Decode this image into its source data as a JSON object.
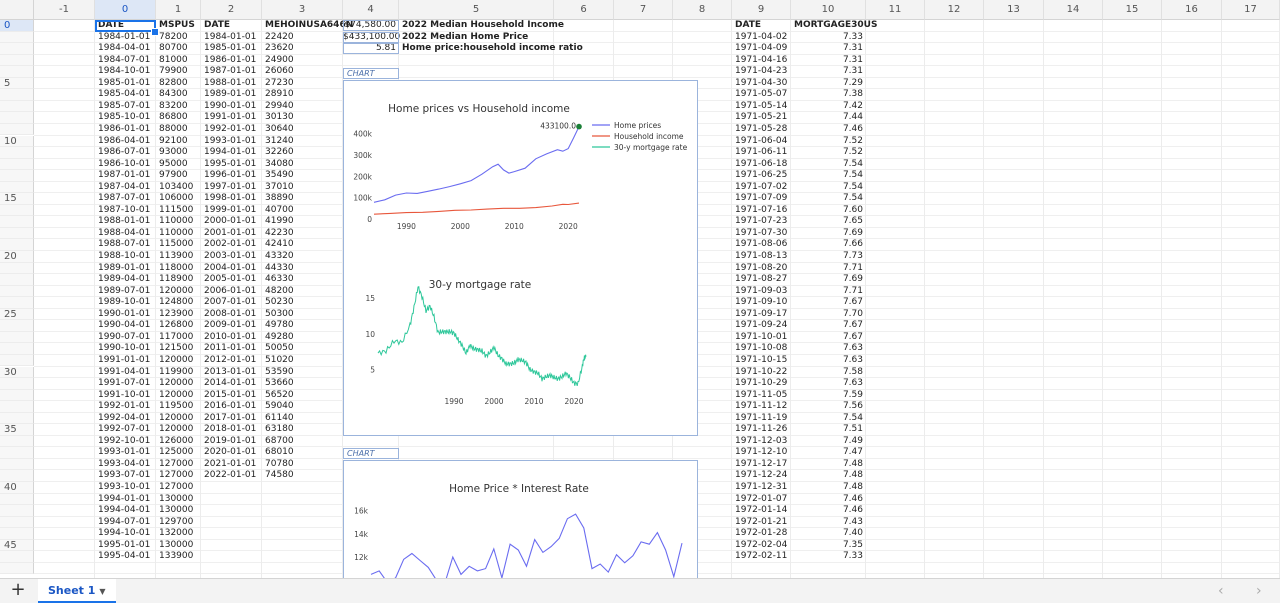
{
  "columns": [
    "-1",
    "0",
    "1",
    "2",
    "3",
    "4",
    "5",
    "6",
    "7",
    "8",
    "9",
    "10",
    "11",
    "12",
    "13",
    "14",
    "15",
    "16",
    "17"
  ],
  "row_markers": [
    "0",
    "5",
    "10",
    "15",
    "20",
    "25",
    "30",
    "35",
    "40",
    "45"
  ],
  "headers": {
    "c0": "DATE",
    "c1": "MSPUS",
    "c2": "DATE",
    "c3": "MEHOINUSA646N",
    "c9": "DATE",
    "c10": "MORTGAGE30US"
  },
  "col0": [
    "1984-01-01",
    "1984-04-01",
    "1984-07-01",
    "1984-10-01",
    "1985-01-01",
    "1985-04-01",
    "1985-07-01",
    "1985-10-01",
    "1986-01-01",
    "1986-04-01",
    "1986-07-01",
    "1986-10-01",
    "1987-01-01",
    "1987-04-01",
    "1987-07-01",
    "1987-10-01",
    "1988-01-01",
    "1988-04-01",
    "1988-07-01",
    "1988-10-01",
    "1989-01-01",
    "1989-04-01",
    "1989-07-01",
    "1989-10-01",
    "1990-01-01",
    "1990-04-01",
    "1990-07-01",
    "1990-10-01",
    "1991-01-01",
    "1991-04-01",
    "1991-07-01",
    "1991-10-01",
    "1992-01-01",
    "1992-04-01",
    "1992-07-01",
    "1992-10-01",
    "1993-01-01",
    "1993-04-01",
    "1993-07-01",
    "1993-10-01",
    "1994-01-01",
    "1994-04-01",
    "1994-07-01",
    "1994-10-01",
    "1995-01-01",
    "1995-04-01"
  ],
  "col1": [
    "78200",
    "80700",
    "81000",
    "79900",
    "82800",
    "84300",
    "83200",
    "86800",
    "88000",
    "92100",
    "93000",
    "95000",
    "97900",
    "103400",
    "106000",
    "111500",
    "110000",
    "110000",
    "115000",
    "113900",
    "118000",
    "118900",
    "120000",
    "124800",
    "123900",
    "126800",
    "117000",
    "121500",
    "120000",
    "119900",
    "120000",
    "120000",
    "119500",
    "120000",
    "120000",
    "126000",
    "125000",
    "127000",
    "127000",
    "127000",
    "130000",
    "130000",
    "129700",
    "132000",
    "130000",
    "133900"
  ],
  "col2": [
    "1984-01-01",
    "1985-01-01",
    "1986-01-01",
    "1987-01-01",
    "1988-01-01",
    "1989-01-01",
    "1990-01-01",
    "1991-01-01",
    "1992-01-01",
    "1993-01-01",
    "1994-01-01",
    "1995-01-01",
    "1996-01-01",
    "1997-01-01",
    "1998-01-01",
    "1999-01-01",
    "2000-01-01",
    "2001-01-01",
    "2002-01-01",
    "2003-01-01",
    "2004-01-01",
    "2005-01-01",
    "2006-01-01",
    "2007-01-01",
    "2008-01-01",
    "2009-01-01",
    "2010-01-01",
    "2011-01-01",
    "2012-01-01",
    "2013-01-01",
    "2014-01-01",
    "2015-01-01",
    "2016-01-01",
    "2017-01-01",
    "2018-01-01",
    "2019-01-01",
    "2020-01-01",
    "2021-01-01",
    "2022-01-01"
  ],
  "col3": [
    "22420",
    "23620",
    "24900",
    "26060",
    "27230",
    "28910",
    "29940",
    "30130",
    "30640",
    "31240",
    "32260",
    "34080",
    "35490",
    "37010",
    "38890",
    "40700",
    "41990",
    "42230",
    "42410",
    "43320",
    "44330",
    "46330",
    "48200",
    "50230",
    "50300",
    "49780",
    "49280",
    "50050",
    "51020",
    "53590",
    "53660",
    "56520",
    "59040",
    "61140",
    "63180",
    "68700",
    "68010",
    "70780",
    "74580"
  ],
  "summary": [
    {
      "value": "$74,580.00",
      "label": "2022 Median Household Income"
    },
    {
      "value": "$433,100.00",
      "label": "2022 Median Home Price"
    },
    {
      "value": "5.81",
      "label": "Home price:household income ratio"
    }
  ],
  "col9": [
    "1971-04-02",
    "1971-04-09",
    "1971-04-16",
    "1971-04-23",
    "1971-04-30",
    "1971-05-07",
    "1971-05-14",
    "1971-05-21",
    "1971-05-28",
    "1971-06-04",
    "1971-06-11",
    "1971-06-18",
    "1971-06-25",
    "1971-07-02",
    "1971-07-09",
    "1971-07-16",
    "1971-07-23",
    "1971-07-30",
    "1971-08-06",
    "1971-08-13",
    "1971-08-20",
    "1971-08-27",
    "1971-09-03",
    "1971-09-10",
    "1971-09-17",
    "1971-09-24",
    "1971-10-01",
    "1971-10-08",
    "1971-10-15",
    "1971-10-22",
    "1971-10-29",
    "1971-11-05",
    "1971-11-12",
    "1971-11-19",
    "1971-11-26",
    "1971-12-03",
    "1971-12-10",
    "1971-12-17",
    "1971-12-24",
    "1971-12-31",
    "1972-01-07",
    "1972-01-14",
    "1972-01-21",
    "1972-01-28",
    "1972-02-04",
    "1972-02-11"
  ],
  "col10": [
    "7.33",
    "7.31",
    "7.31",
    "7.31",
    "7.29",
    "7.38",
    "7.42",
    "7.44",
    "7.46",
    "7.52",
    "7.52",
    "7.54",
    "7.54",
    "7.54",
    "7.54",
    "7.60",
    "7.65",
    "7.69",
    "7.66",
    "7.73",
    "7.71",
    "7.69",
    "7.71",
    "7.67",
    "7.70",
    "7.67",
    "7.67",
    "7.63",
    "7.63",
    "7.58",
    "7.63",
    "7.59",
    "7.56",
    "7.54",
    "7.51",
    "7.49",
    "7.47",
    "7.48",
    "7.48",
    "7.48",
    "7.46",
    "7.46",
    "7.43",
    "7.40",
    "7.35",
    "7.33"
  ],
  "chart_tag_label": "CHART",
  "sheet_tab": "Sheet 1",
  "add_sheet": "+",
  "chart_data": [
    {
      "type": "line",
      "title": "Home prices vs Household income",
      "xlim": [
        1984,
        2022
      ],
      "ylim": [
        0,
        450000
      ],
      "y_ticks": [
        {
          "v": 0,
          "label": "0"
        },
        {
          "v": 100000,
          "label": "100k"
        },
        {
          "v": 200000,
          "label": "200k"
        },
        {
          "v": 300000,
          "label": "300k"
        },
        {
          "v": 400000,
          "label": "400k"
        }
      ],
      "x_ticks": [
        1990,
        2000,
        2010,
        2020
      ],
      "annotation": {
        "x": 2022,
        "y": 433100,
        "label": "433100.0"
      },
      "legend_position": "top-right",
      "series": [
        {
          "name": "Home prices",
          "color": "#6a6cf0",
          "points": [
            [
              1984,
              78200
            ],
            [
              1986,
              90000
            ],
            [
              1988,
              112000
            ],
            [
              1990,
              122000
            ],
            [
              1992,
              120000
            ],
            [
              1994,
              130000
            ],
            [
              1996,
              140000
            ],
            [
              1998,
              152000
            ],
            [
              2000,
              165000
            ],
            [
              2002,
              180000
            ],
            [
              2004,
              210000
            ],
            [
              2006,
              245000
            ],
            [
              2007,
              257000
            ],
            [
              2008,
              230000
            ],
            [
              2009,
              215000
            ],
            [
              2010,
              222000
            ],
            [
              2012,
              238000
            ],
            [
              2014,
              282000
            ],
            [
              2016,
              305000
            ],
            [
              2018,
              325000
            ],
            [
              2019,
              318000
            ],
            [
              2020,
              330000
            ],
            [
              2021,
              380000
            ],
            [
              2022,
              433100
            ]
          ]
        },
        {
          "name": "Household income",
          "color": "#e8573c",
          "points": [
            [
              1984,
              22420
            ],
            [
              1987,
              26060
            ],
            [
              1990,
              29940
            ],
            [
              1993,
              31240
            ],
            [
              1996,
              35490
            ],
            [
              1999,
              40700
            ],
            [
              2002,
              42410
            ],
            [
              2005,
              46330
            ],
            [
              2008,
              50300
            ],
            [
              2011,
              50050
            ],
            [
              2014,
              53660
            ],
            [
              2017,
              61140
            ],
            [
              2019,
              68700
            ],
            [
              2020,
              68010
            ],
            [
              2022,
              74580
            ]
          ]
        },
        {
          "name": "30-y mortgage rate",
          "color": "#2ec79a",
          "points": []
        }
      ]
    },
    {
      "type": "line",
      "title": "30-y mortgage rate",
      "xlim": [
        1971,
        2023
      ],
      "ylim": [
        2,
        16
      ],
      "y_ticks": [
        {
          "v": 5,
          "label": "5"
        },
        {
          "v": 10,
          "label": "10"
        },
        {
          "v": 15,
          "label": "15"
        }
      ],
      "x_ticks": [
        1990,
        2000,
        2010,
        2020
      ],
      "series": [
        {
          "name": "30-y mortgage rate",
          "color": "#2ec79a",
          "points": [
            [
              1971,
              7.3
            ],
            [
              1973,
              7.6
            ],
            [
              1975,
              9.0
            ],
            [
              1977,
              8.8
            ],
            [
              1979,
              11.2
            ],
            [
              1980,
              13.7
            ],
            [
              1981,
              16.6
            ],
            [
              1982,
              15.2
            ],
            [
              1983,
              13.2
            ],
            [
              1984,
              13.9
            ],
            [
              1985,
              12.4
            ],
            [
              1986,
              10.2
            ],
            [
              1987,
              10.3
            ],
            [
              1988,
              10.3
            ],
            [
              1989,
              10.3
            ],
            [
              1990,
              10.1
            ],
            [
              1991,
              9.2
            ],
            [
              1992,
              8.4
            ],
            [
              1993,
              7.3
            ],
            [
              1994,
              8.4
            ],
            [
              1995,
              7.9
            ],
            [
              1996,
              7.8
            ],
            [
              1997,
              7.6
            ],
            [
              1998,
              6.9
            ],
            [
              1999,
              7.4
            ],
            [
              2000,
              8.1
            ],
            [
              2001,
              7.0
            ],
            [
              2002,
              6.5
            ],
            [
              2003,
              5.8
            ],
            [
              2004,
              5.8
            ],
            [
              2005,
              5.9
            ],
            [
              2006,
              6.4
            ],
            [
              2007,
              6.3
            ],
            [
              2008,
              6.0
            ],
            [
              2009,
              5.0
            ],
            [
              2010,
              4.7
            ],
            [
              2011,
              4.5
            ],
            [
              2012,
              3.7
            ],
            [
              2013,
              4.0
            ],
            [
              2014,
              4.2
            ],
            [
              2015,
              3.9
            ],
            [
              2016,
              3.7
            ],
            [
              2017,
              4.0
            ],
            [
              2018,
              4.5
            ],
            [
              2019,
              3.9
            ],
            [
              2020,
              3.1
            ],
            [
              2021,
              3.0
            ],
            [
              2022,
              5.3
            ],
            [
              2022.5,
              6.6
            ],
            [
              2023,
              6.8
            ]
          ]
        }
      ]
    },
    {
      "type": "line",
      "title": "Home Price * Interest Rate",
      "ylim": [
        9500,
        17000
      ],
      "y_ticks": [
        {
          "v": 12000,
          "label": "12k"
        },
        {
          "v": 14000,
          "label": "14k"
        },
        {
          "v": 16000,
          "label": "16k"
        }
      ],
      "series": [
        {
          "name": "Home Price * Interest Rate",
          "color": "#6a6cf0",
          "values": [
            10500,
            10800,
            9800,
            10200,
            11800,
            12300,
            11700,
            11100,
            10000,
            9700,
            12000,
            10500,
            11200,
            10800,
            11000,
            12700,
            10200,
            13100,
            12600,
            11200,
            13500,
            12400,
            12900,
            13600,
            15300,
            15700,
            14500,
            11000,
            11400,
            10700,
            12200,
            11500,
            12100,
            13300,
            13100,
            14100,
            12600,
            10300,
            13200
          ]
        }
      ]
    }
  ]
}
